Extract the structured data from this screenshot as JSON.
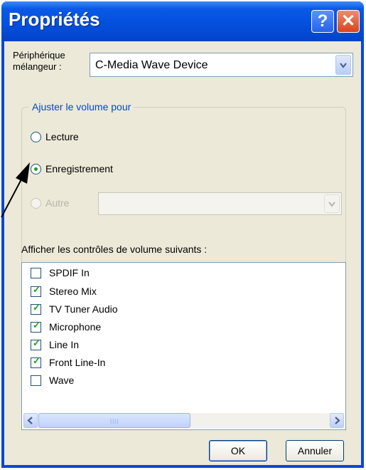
{
  "window": {
    "title": "Propriétés"
  },
  "titlebar": {
    "help_glyph": "?",
    "close_glyph": "✕"
  },
  "mixer": {
    "label": "Périphérique\nmélangeur :",
    "label_line1": "Périphérique",
    "label_line2": "mélangeur :",
    "device": "C-Media Wave Device"
  },
  "volume_group": {
    "title": "Ajuster le volume pour",
    "options": [
      {
        "label": "Lecture",
        "selected": false,
        "enabled": true
      },
      {
        "label": "Enregistrement",
        "selected": true,
        "enabled": true
      },
      {
        "label": "Autre",
        "selected": false,
        "enabled": false
      }
    ],
    "other_device": ""
  },
  "controls_label": "Afficher les contrôles de volume suivants :",
  "controls": [
    {
      "label": "SPDIF In",
      "checked": false
    },
    {
      "label": "Stereo Mix",
      "checked": true
    },
    {
      "label": "TV Tuner Audio",
      "checked": true
    },
    {
      "label": "Microphone",
      "checked": true
    },
    {
      "label": "Line In",
      "checked": true
    },
    {
      "label": "Front Line-In",
      "checked": true
    },
    {
      "label": "Wave",
      "checked": false
    }
  ],
  "buttons": {
    "ok": "OK",
    "cancel": "Annuler"
  },
  "colors": {
    "titlebar": "#0450de",
    "dialog_bg": "#ece9d8",
    "group_title": "#0046d5",
    "check": "#21a121"
  },
  "icons": {
    "dropdown": "chevron-down-icon",
    "scroll_left": "arrow-left-icon",
    "scroll_right": "arrow-right-icon"
  }
}
